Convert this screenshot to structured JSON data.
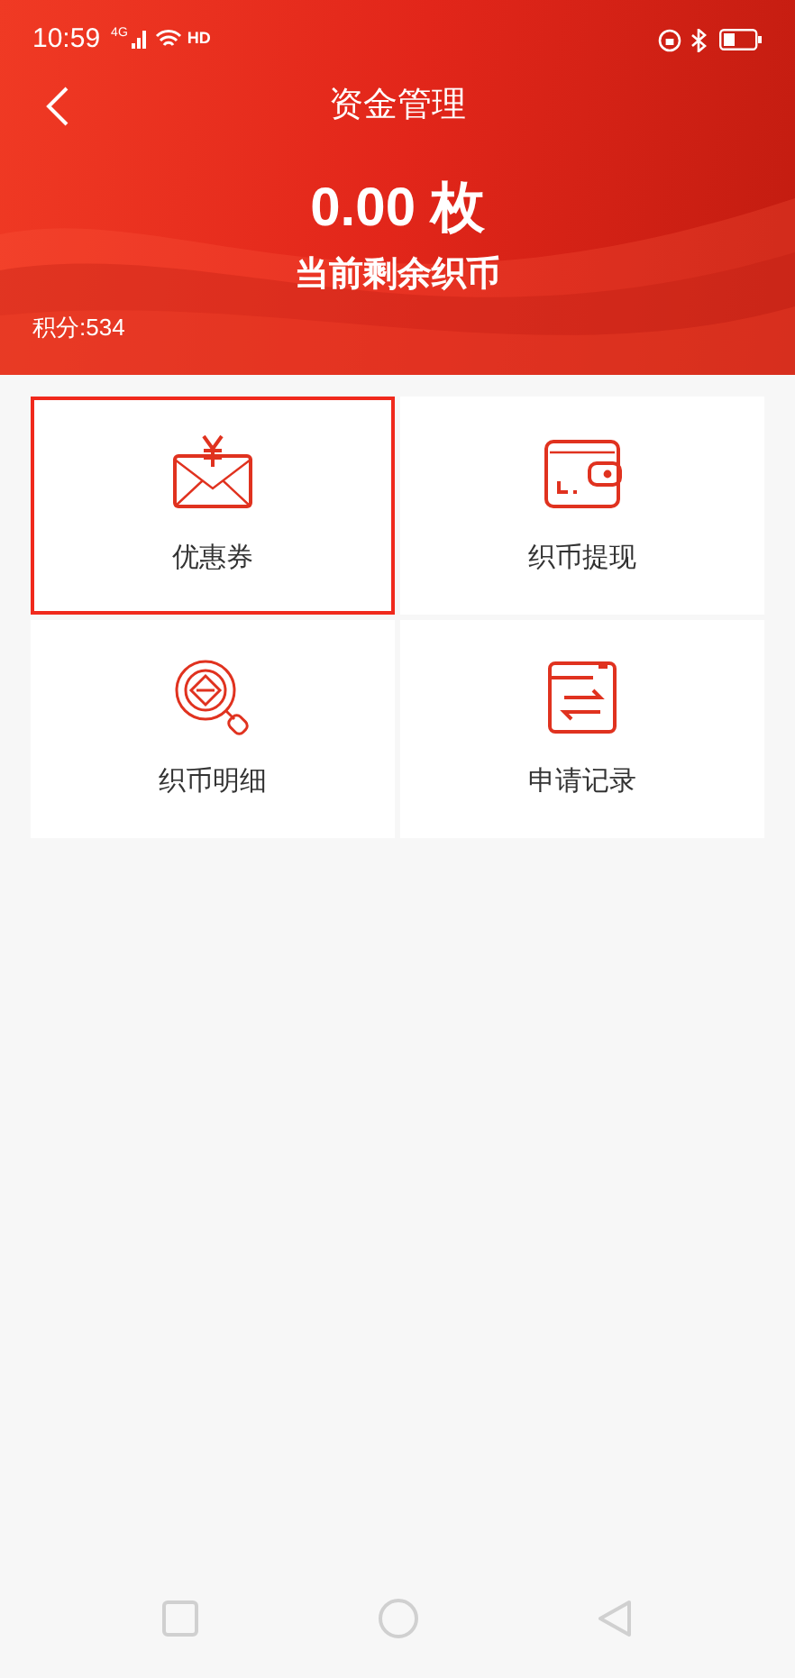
{
  "status_bar": {
    "time": "10:59",
    "network": "4G",
    "hd": "HD"
  },
  "header": {
    "title": "资金管理",
    "amount": "0.00 枚",
    "caption": "当前剩余织币",
    "points": "积分:534"
  },
  "tiles": [
    {
      "kind": "coupon",
      "label": "优惠券",
      "selected": true
    },
    {
      "kind": "wallet",
      "label": "织币提现",
      "selected": false
    },
    {
      "kind": "details",
      "label": "织币明细",
      "selected": false
    },
    {
      "kind": "records",
      "label": "申请记录",
      "selected": false
    }
  ]
}
